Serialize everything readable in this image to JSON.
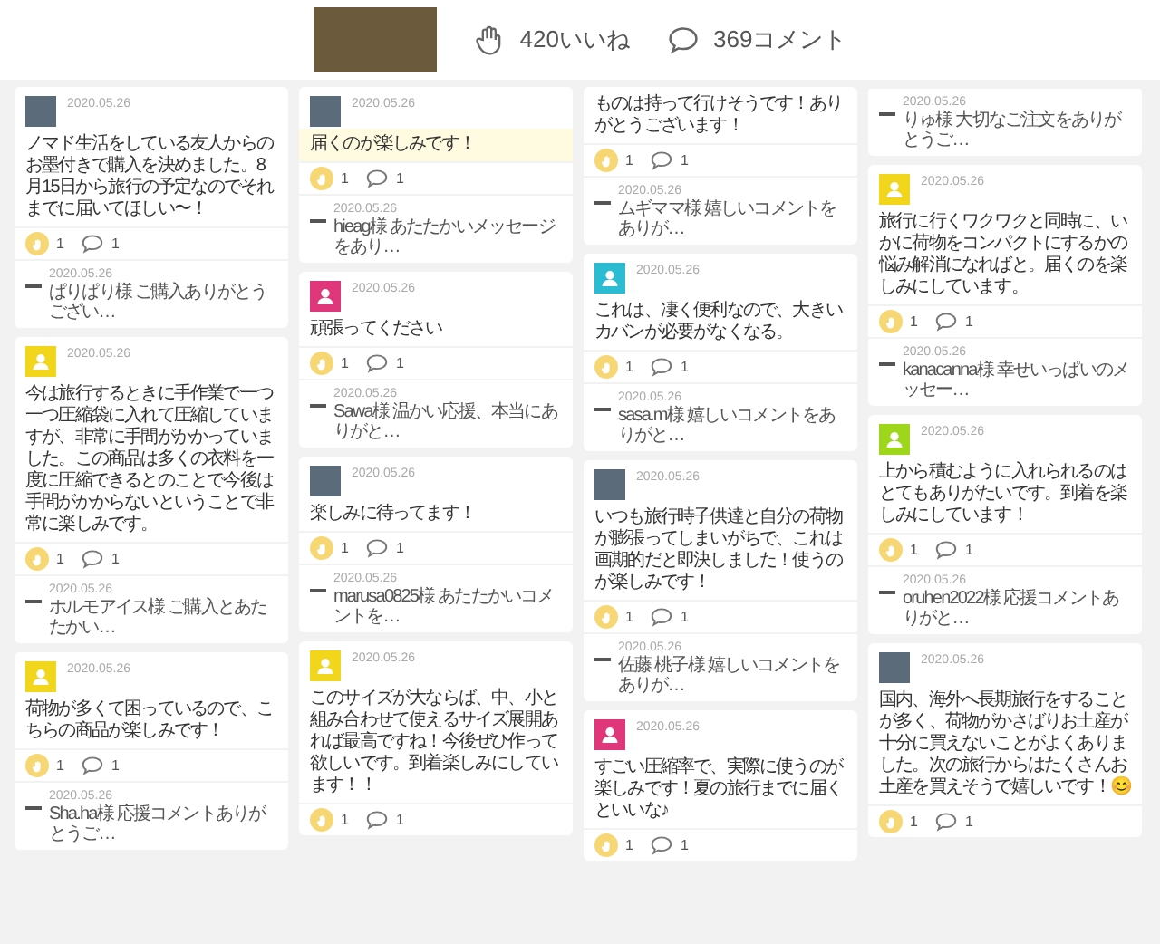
{
  "header": {
    "likes": "420いいね",
    "comments": "369コメント"
  },
  "columns": [
    {
      "cards": [
        {
          "avatar": {
            "kind": "photo"
          },
          "date": "2020.05.26",
          "text": "ノマド生活をしている友人からのお墨付きで購入を決めました。8月15日から旅行の予定なのでそれまでに届いてほしい〜！",
          "highlighted": false,
          "likes": "1",
          "comments": "1",
          "reply": {
            "date": "2020.05.26",
            "text": "ぱりぱり様 ご購入ありがとうござい…"
          }
        },
        {
          "avatar": {
            "kind": "default",
            "color": "#f2d61c"
          },
          "date": "2020.05.26",
          "text": "今は旅行するときに手作業で一つ一つ圧縮袋に入れて圧縮していますが、非常に手間がかかっていました。この商品は多くの衣料を一度に圧縮できるとのことで今後は手間がかからないということで非常に楽しみです。",
          "highlighted": false,
          "likes": "1",
          "comments": "1",
          "reply": {
            "date": "2020.05.26",
            "text": "ホルモアイス様 ご購入とあたたかい…"
          }
        },
        {
          "avatar": {
            "kind": "default",
            "color": "#f2d61c"
          },
          "date": "2020.05.26",
          "text": "荷物が多くて困っているので、こちらの商品が楽しみです！",
          "highlighted": false,
          "likes": "1",
          "comments": "1",
          "reply": {
            "date": "2020.05.26",
            "text": "Sha.ha様 応援コメントありがとうご…"
          }
        }
      ]
    },
    {
      "cards": [
        {
          "avatar": {
            "kind": "photo"
          },
          "date": "2020.05.26",
          "text": "届くのが楽しみです！",
          "highlighted": true,
          "likes": "1",
          "comments": "1",
          "reply": {
            "date": "2020.05.26",
            "text": "hieag様 あたたかいメッセージをあり…"
          }
        },
        {
          "avatar": {
            "kind": "default",
            "color": "#e0377a"
          },
          "date": "2020.05.26",
          "text": "頑張ってください",
          "highlighted": false,
          "likes": "1",
          "comments": "1",
          "reply": {
            "date": "2020.05.26",
            "text": "Sawa様 温かい応援、本当にありがと…"
          }
        },
        {
          "avatar": {
            "kind": "photo"
          },
          "date": "2020.05.26",
          "text": "楽しみに待ってます！",
          "highlighted": false,
          "likes": "1",
          "comments": "1",
          "reply": {
            "date": "2020.05.26",
            "text": "marusa0825様 あたたかいコメントを…"
          }
        },
        {
          "avatar": {
            "kind": "default",
            "color": "#f2d61c"
          },
          "date": "2020.05.26",
          "text": "このサイズが大ならば、中、小と組み合わせて使えるサイズ展開あれば最高ですね！今後ぜひ作って欲しいです。到着楽しみにしています！！",
          "highlighted": false,
          "likes": "1",
          "comments": "1"
        }
      ]
    },
    {
      "cards": [
        {
          "text": "ものは持って行けそうです！ありがとうございます！",
          "highlighted": false,
          "likes": "1",
          "comments": "1",
          "reply": {
            "date": "2020.05.26",
            "text": "ムギママ様 嬉しいコメントをありが…"
          }
        },
        {
          "avatar": {
            "kind": "default",
            "color": "#2bbcd4"
          },
          "date": "2020.05.26",
          "text": "これは、凄く便利なので、大きいカバンが必要がなくなる。",
          "highlighted": false,
          "likes": "1",
          "comments": "1",
          "reply": {
            "date": "2020.05.26",
            "text": "sasa.m様 嬉しいコメントをありがと…"
          }
        },
        {
          "avatar": {
            "kind": "photo"
          },
          "date": "2020.05.26",
          "text": "いつも旅行時子供達と自分の荷物が膨張ってしまいがちで、これは画期的だと即決しました！使うのが楽しみです！",
          "highlighted": false,
          "likes": "1",
          "comments": "1",
          "reply": {
            "date": "2020.05.26",
            "text": "佐藤 桃子様 嬉しいコメントをありが…"
          }
        },
        {
          "avatar": {
            "kind": "default",
            "color": "#e0377a"
          },
          "date": "2020.05.26",
          "text": "すごい圧縮率で、実際に使うのが楽しみです！夏の旅行までに届くといいな♪",
          "highlighted": false,
          "likes": "1",
          "comments": "1"
        }
      ]
    },
    {
      "cards": [
        {
          "reply": {
            "date": "2020.05.26",
            "text": "りゅ様 大切なご注文をありがとうご…"
          }
        },
        {
          "avatar": {
            "kind": "default",
            "color": "#f2d61c"
          },
          "date": "2020.05.26",
          "text": "旅行に行くワクワクと同時に、いかに荷物をコンパクトにするかの悩み解消になればと。届くのを楽しみにしています。",
          "highlighted": false,
          "likes": "1",
          "comments": "1",
          "reply": {
            "date": "2020.05.26",
            "text": "kanacanna様 幸せいっぱいのメッセー…"
          }
        },
        {
          "avatar": {
            "kind": "default",
            "color": "#9ed61c"
          },
          "date": "2020.05.26",
          "text": "上から積むように入れられるのはとてもありがたいです。到着を楽しみにしています！",
          "highlighted": false,
          "likes": "1",
          "comments": "1",
          "reply": {
            "date": "2020.05.26",
            "text": "oruhen2022様 応援コメントありがと…"
          }
        },
        {
          "avatar": {
            "kind": "photo"
          },
          "date": "2020.05.26",
          "text": "国内、海外へ長期旅行をすることが多く、荷物がかさばりお土産が十分に買えないことがよくありました。次の旅行からはたくさんお土産を買えそうで嬉しいです！😊",
          "highlighted": false,
          "likes": "1",
          "comments": "1"
        }
      ]
    }
  ]
}
